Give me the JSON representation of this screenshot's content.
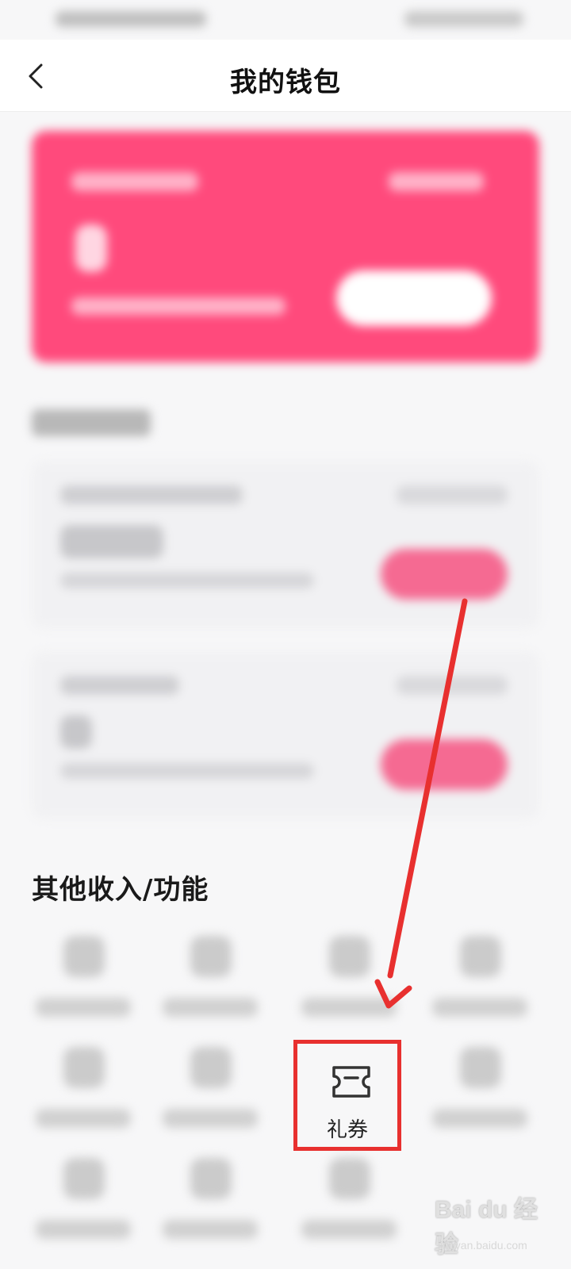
{
  "header": {
    "title": "我的钱包"
  },
  "section_other": {
    "title": "其他收入/功能"
  },
  "coupon": {
    "label": "礼券"
  },
  "colors": {
    "accent_pink": "#ff4a7c",
    "highlight_red": "#e8302f"
  },
  "icons": {
    "back": "chevron-left-icon",
    "coupon": "ticket-icon"
  },
  "watermark": {
    "name": "Bai du 经验",
    "site": "jingyan.baidu.com"
  }
}
